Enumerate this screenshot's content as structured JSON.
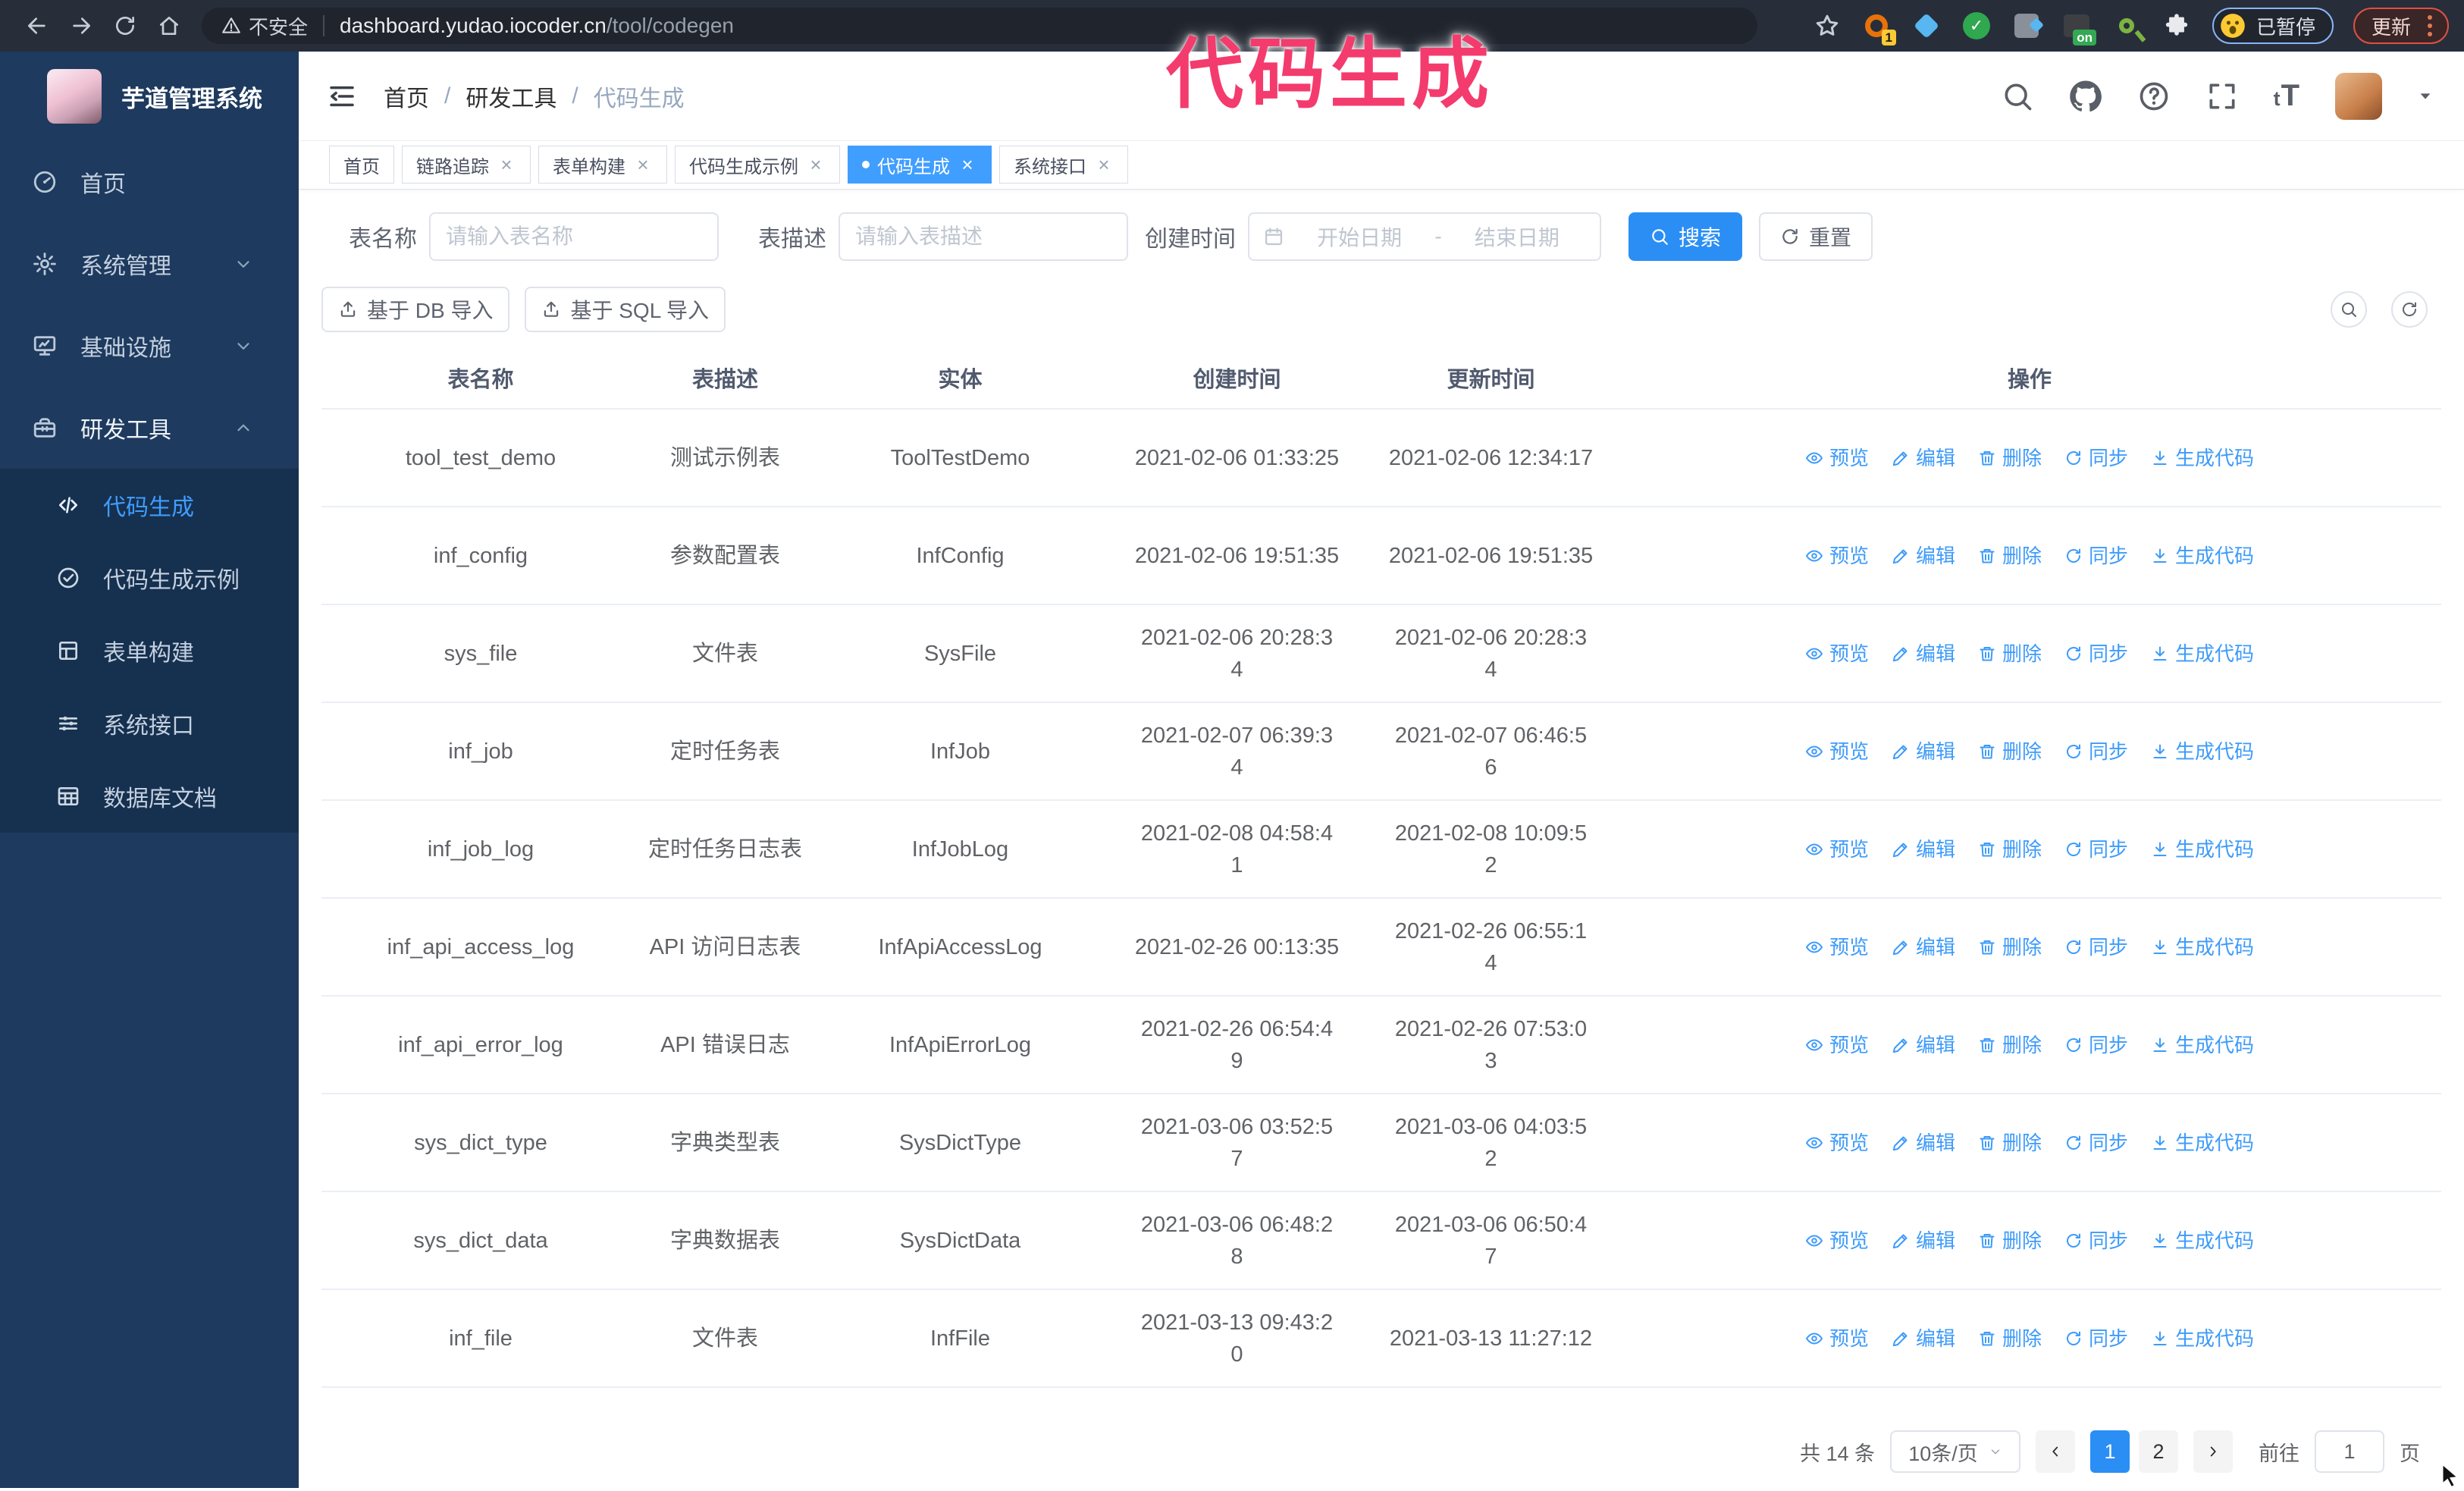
{
  "overlay_caption": "代码生成",
  "browser": {
    "security_label": "不安全",
    "url_domain": "dashboard.yudao.iocoder.cn",
    "url_path": "/tool/codegen",
    "extensions": [
      {
        "name": "orange-ring-extension-icon",
        "badge": "1"
      },
      {
        "name": "gem-extension-icon",
        "badge": ""
      },
      {
        "name": "shield-check-extension-icon",
        "badge": ""
      },
      {
        "name": "panels-extension-icon",
        "badge": ""
      },
      {
        "name": "dark-extension-icon",
        "badge": "on"
      },
      {
        "name": "key-extension-icon",
        "badge": ""
      },
      {
        "name": "puzzle-extension-icon",
        "badge": ""
      }
    ],
    "paused_label": "已暂停",
    "update_label": "更新"
  },
  "sidebar": {
    "logo_title": "芋道管理系统",
    "items": [
      {
        "key": "home",
        "label": "首页",
        "icon": "dashboard-icon",
        "chevron": ""
      },
      {
        "key": "system",
        "label": "系统管理",
        "icon": "gear-icon",
        "chevron": "down"
      },
      {
        "key": "infra",
        "label": "基础设施",
        "icon": "monitor-icon",
        "chevron": "down"
      },
      {
        "key": "devtools",
        "label": "研发工具",
        "icon": "toolbox-icon",
        "chevron": "up",
        "expanded": true
      }
    ],
    "submenu": [
      {
        "key": "codegen",
        "label": "代码生成",
        "icon": "code-icon",
        "active": true
      },
      {
        "key": "codegen-example",
        "label": "代码生成示例",
        "icon": "badge-check-icon",
        "active": false
      },
      {
        "key": "form-builder",
        "label": "表单构建",
        "icon": "form-icon",
        "active": false
      },
      {
        "key": "system-api",
        "label": "系统接口",
        "icon": "sliders-icon",
        "active": false
      },
      {
        "key": "db-doc",
        "label": "数据库文档",
        "icon": "dbtable-icon",
        "active": false
      }
    ]
  },
  "header": {
    "breadcrumb": [
      "首页",
      "研发工具",
      "代码生成"
    ]
  },
  "tabs": [
    {
      "key": "home",
      "label": "首页",
      "closable": false,
      "active": false
    },
    {
      "key": "trace",
      "label": "链路追踪",
      "closable": true,
      "active": false
    },
    {
      "key": "form-builder",
      "label": "表单构建",
      "closable": true,
      "active": false
    },
    {
      "key": "codegen-example",
      "label": "代码生成示例",
      "closable": true,
      "active": false
    },
    {
      "key": "codegen",
      "label": "代码生成",
      "closable": true,
      "active": true
    },
    {
      "key": "system-api",
      "label": "系统接口",
      "closable": true,
      "active": false
    }
  ],
  "filters": {
    "table_name_label": "表名称",
    "table_name_placeholder": "请输入表名称",
    "table_desc_label": "表描述",
    "table_desc_placeholder": "请输入表描述",
    "create_time_label": "创建时间",
    "date_start_placeholder": "开始日期",
    "date_separator": "-",
    "date_end_placeholder": "结束日期",
    "search_label": "搜索",
    "reset_label": "重置"
  },
  "toolbar": {
    "import_db_label": "基于 DB 导入",
    "import_sql_label": "基于 SQL 导入"
  },
  "table": {
    "columns": [
      "表名称",
      "表描述",
      "实体",
      "创建时间",
      "更新时间",
      "操作"
    ],
    "actions": [
      {
        "key": "preview",
        "label": "预览",
        "icon": "eye-icon"
      },
      {
        "key": "edit",
        "label": "编辑",
        "icon": "edit-icon"
      },
      {
        "key": "delete",
        "label": "删除",
        "icon": "delete-icon"
      },
      {
        "key": "sync",
        "label": "同步",
        "icon": "sync-icon"
      },
      {
        "key": "generate",
        "label": "生成代码",
        "icon": "download-icon"
      }
    ],
    "rows": [
      {
        "name": "tool_test_demo",
        "desc": "测试示例表",
        "entity": "ToolTestDemo",
        "created": "2021-02-06 01:33:25",
        "updated": "2021-02-06 12:34:17"
      },
      {
        "name": "inf_config",
        "desc": "参数配置表",
        "entity": "InfConfig",
        "created": "2021-02-06 19:51:35",
        "updated": "2021-02-06 19:51:35"
      },
      {
        "name": "sys_file",
        "desc": "文件表",
        "entity": "SysFile",
        "created": "2021-02-06 20:28:34",
        "created_wrap": 18,
        "updated": "2021-02-06 20:28:34",
        "updated_wrap": 18
      },
      {
        "name": "inf_job",
        "desc": "定时任务表",
        "entity": "InfJob",
        "created": "2021-02-07 06:39:34",
        "created_wrap": 18,
        "updated": "2021-02-07 06:46:56",
        "updated_wrap": 18
      },
      {
        "name": "inf_job_log",
        "desc": "定时任务日志表",
        "entity": "InfJobLog",
        "created": "2021-02-08 04:58:41",
        "created_wrap": 18,
        "updated": "2021-02-08 10:09:52",
        "updated_wrap": 18
      },
      {
        "name": "inf_api_access_log",
        "desc": "API 访问日志表",
        "entity": "InfApiAccessLog",
        "created": "2021-02-26 00:13:35",
        "updated": "2021-02-26 06:55:14",
        "updated_wrap": 18
      },
      {
        "name": "inf_api_error_log",
        "desc": "API 错误日志",
        "entity": "InfApiErrorLog",
        "created": "2021-02-26 06:54:49",
        "created_wrap": 18,
        "updated": "2021-02-26 07:53:03",
        "updated_wrap": 18
      },
      {
        "name": "sys_dict_type",
        "desc": "字典类型表",
        "entity": "SysDictType",
        "created": "2021-03-06 03:52:57",
        "created_wrap": 18,
        "updated": "2021-03-06 04:03:52",
        "updated_wrap": 18
      },
      {
        "name": "sys_dict_data",
        "desc": "字典数据表",
        "entity": "SysDictData",
        "created": "2021-03-06 06:48:28",
        "created_wrap": 18,
        "updated": "2021-03-06 06:50:47",
        "updated_wrap": 18
      },
      {
        "name": "inf_file",
        "desc": "文件表",
        "entity": "InfFile",
        "created": "2021-03-13 09:43:20",
        "created_wrap": 18,
        "updated": "2021-03-13 11:27:12"
      }
    ]
  },
  "pagination": {
    "total_label": "共 14 条",
    "page_size_label": "10条/页",
    "pages": [
      "1",
      "2"
    ],
    "active_page": "1",
    "goto_label": "前往",
    "goto_value": "1",
    "page_unit_label": "页"
  },
  "colors": {
    "accent": "#409eff",
    "caption": "#f43b6e",
    "sidebar_bg": "#1e3a5e",
    "submenu_bg": "#16304f",
    "tab_active_bg": "#409eff"
  }
}
